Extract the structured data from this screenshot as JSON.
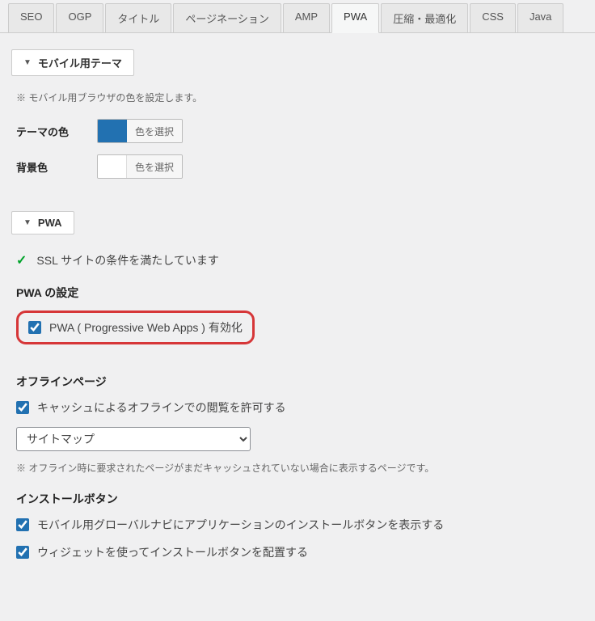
{
  "tabs": [
    {
      "label": "SEO"
    },
    {
      "label": "OGP"
    },
    {
      "label": "タイトル"
    },
    {
      "label": "ページネーション"
    },
    {
      "label": "AMP"
    },
    {
      "label": "PWA",
      "active": true
    },
    {
      "label": "圧縮・最適化"
    },
    {
      "label": "CSS"
    },
    {
      "label": "Java"
    }
  ],
  "mobileTheme": {
    "title": "モバイル用テーマ",
    "note": "※ モバイル用ブラウザの色を設定します。",
    "themeColorLabel": "テーマの色",
    "bgColorLabel": "背景色",
    "colorBtnLabel": "色を選択"
  },
  "pwa": {
    "title": "PWA",
    "sslText": "SSL サイトの条件を満たしています",
    "settingsHeading": "PWA の設定",
    "enableLabel": "PWA ( Progressive Web Apps ) 有効化",
    "offlineHeading": "オフラインページ",
    "offlineCacheLabel": "キャッシュによるオフラインでの閲覧を許可する",
    "offlineSelectOptions": [
      "サイトマップ"
    ],
    "offlineSelectValue": "サイトマップ",
    "offlineNote": "※ オフライン時に要求されたページがまだキャッシュされていない場合に表示するページです。",
    "installHeading": "インストールボタン",
    "installMobileNavLabel": "モバイル用グローバルナビにアプリケーションのインストールボタンを表示する",
    "installWidgetLabel": "ウィジェットを使ってインストールボタンを配置する"
  }
}
